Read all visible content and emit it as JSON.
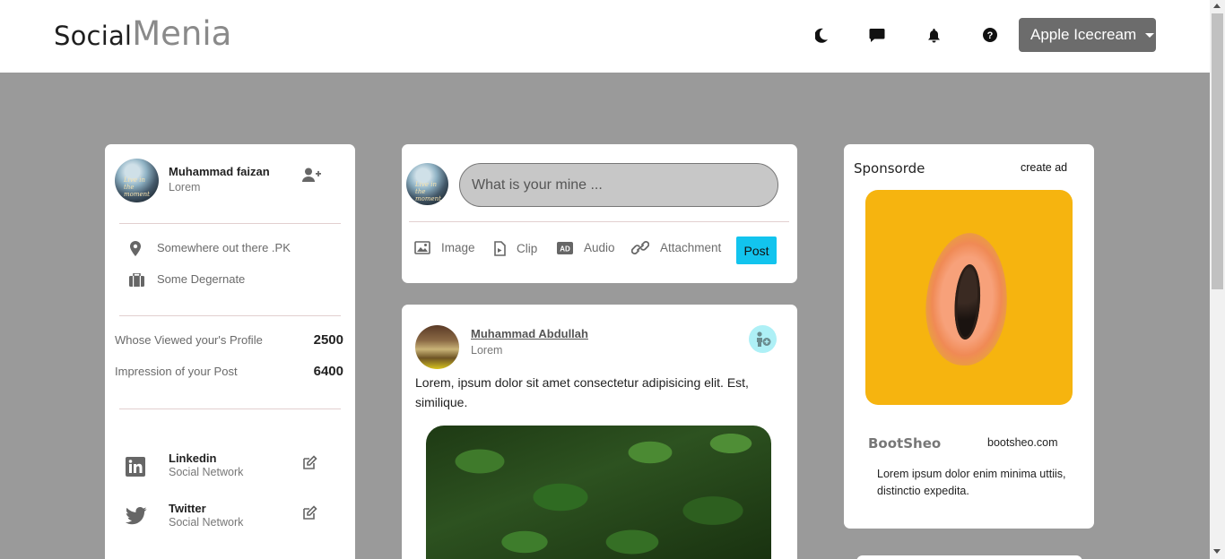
{
  "brand": {
    "part1": "Social",
    "part2": "Menia"
  },
  "nav": {
    "icons": [
      "moon-icon",
      "chat-icon",
      "bell-icon",
      "help-icon"
    ],
    "user_label": "Apple Icecream"
  },
  "profile": {
    "avatar_text": "Live in the moment",
    "name": "Muhammad faizan",
    "subtitle": "Lorem",
    "location": "Somewhere out there .PK",
    "occupation": "Some Degernate",
    "stats": [
      {
        "label": "Whose Viewed your's Profile",
        "value": "2500"
      },
      {
        "label": "Impression of your Post",
        "value": "6400"
      }
    ],
    "socials": [
      {
        "name": "Linkedin",
        "type": "Social Network"
      },
      {
        "name": "Twitter",
        "type": "Social Network"
      }
    ]
  },
  "compose": {
    "placeholder": "What is your mine ...",
    "tools": [
      "Image",
      "Clip",
      "Audio",
      "Attachment"
    ],
    "post_label": "Post"
  },
  "feed": {
    "author": "Muhammad Abdullah",
    "subtitle": "Lorem",
    "text": "Lorem, ipsum dolor sit amet consectetur adipisicing elit. Est, similique."
  },
  "sponsor": {
    "title": "Sponsorde",
    "create_ad": "create ad",
    "brand": "BootSheo",
    "url": "bootsheo.com",
    "text": "Lorem ipsum dolor enim minima uttiis, distinctio expedita."
  },
  "colors": {
    "page_bg": "#9a9a9a",
    "dropdown_bg": "#6c6c6c",
    "post_button": "#12c4ee",
    "sponsor_bg": "#f6b40f"
  }
}
